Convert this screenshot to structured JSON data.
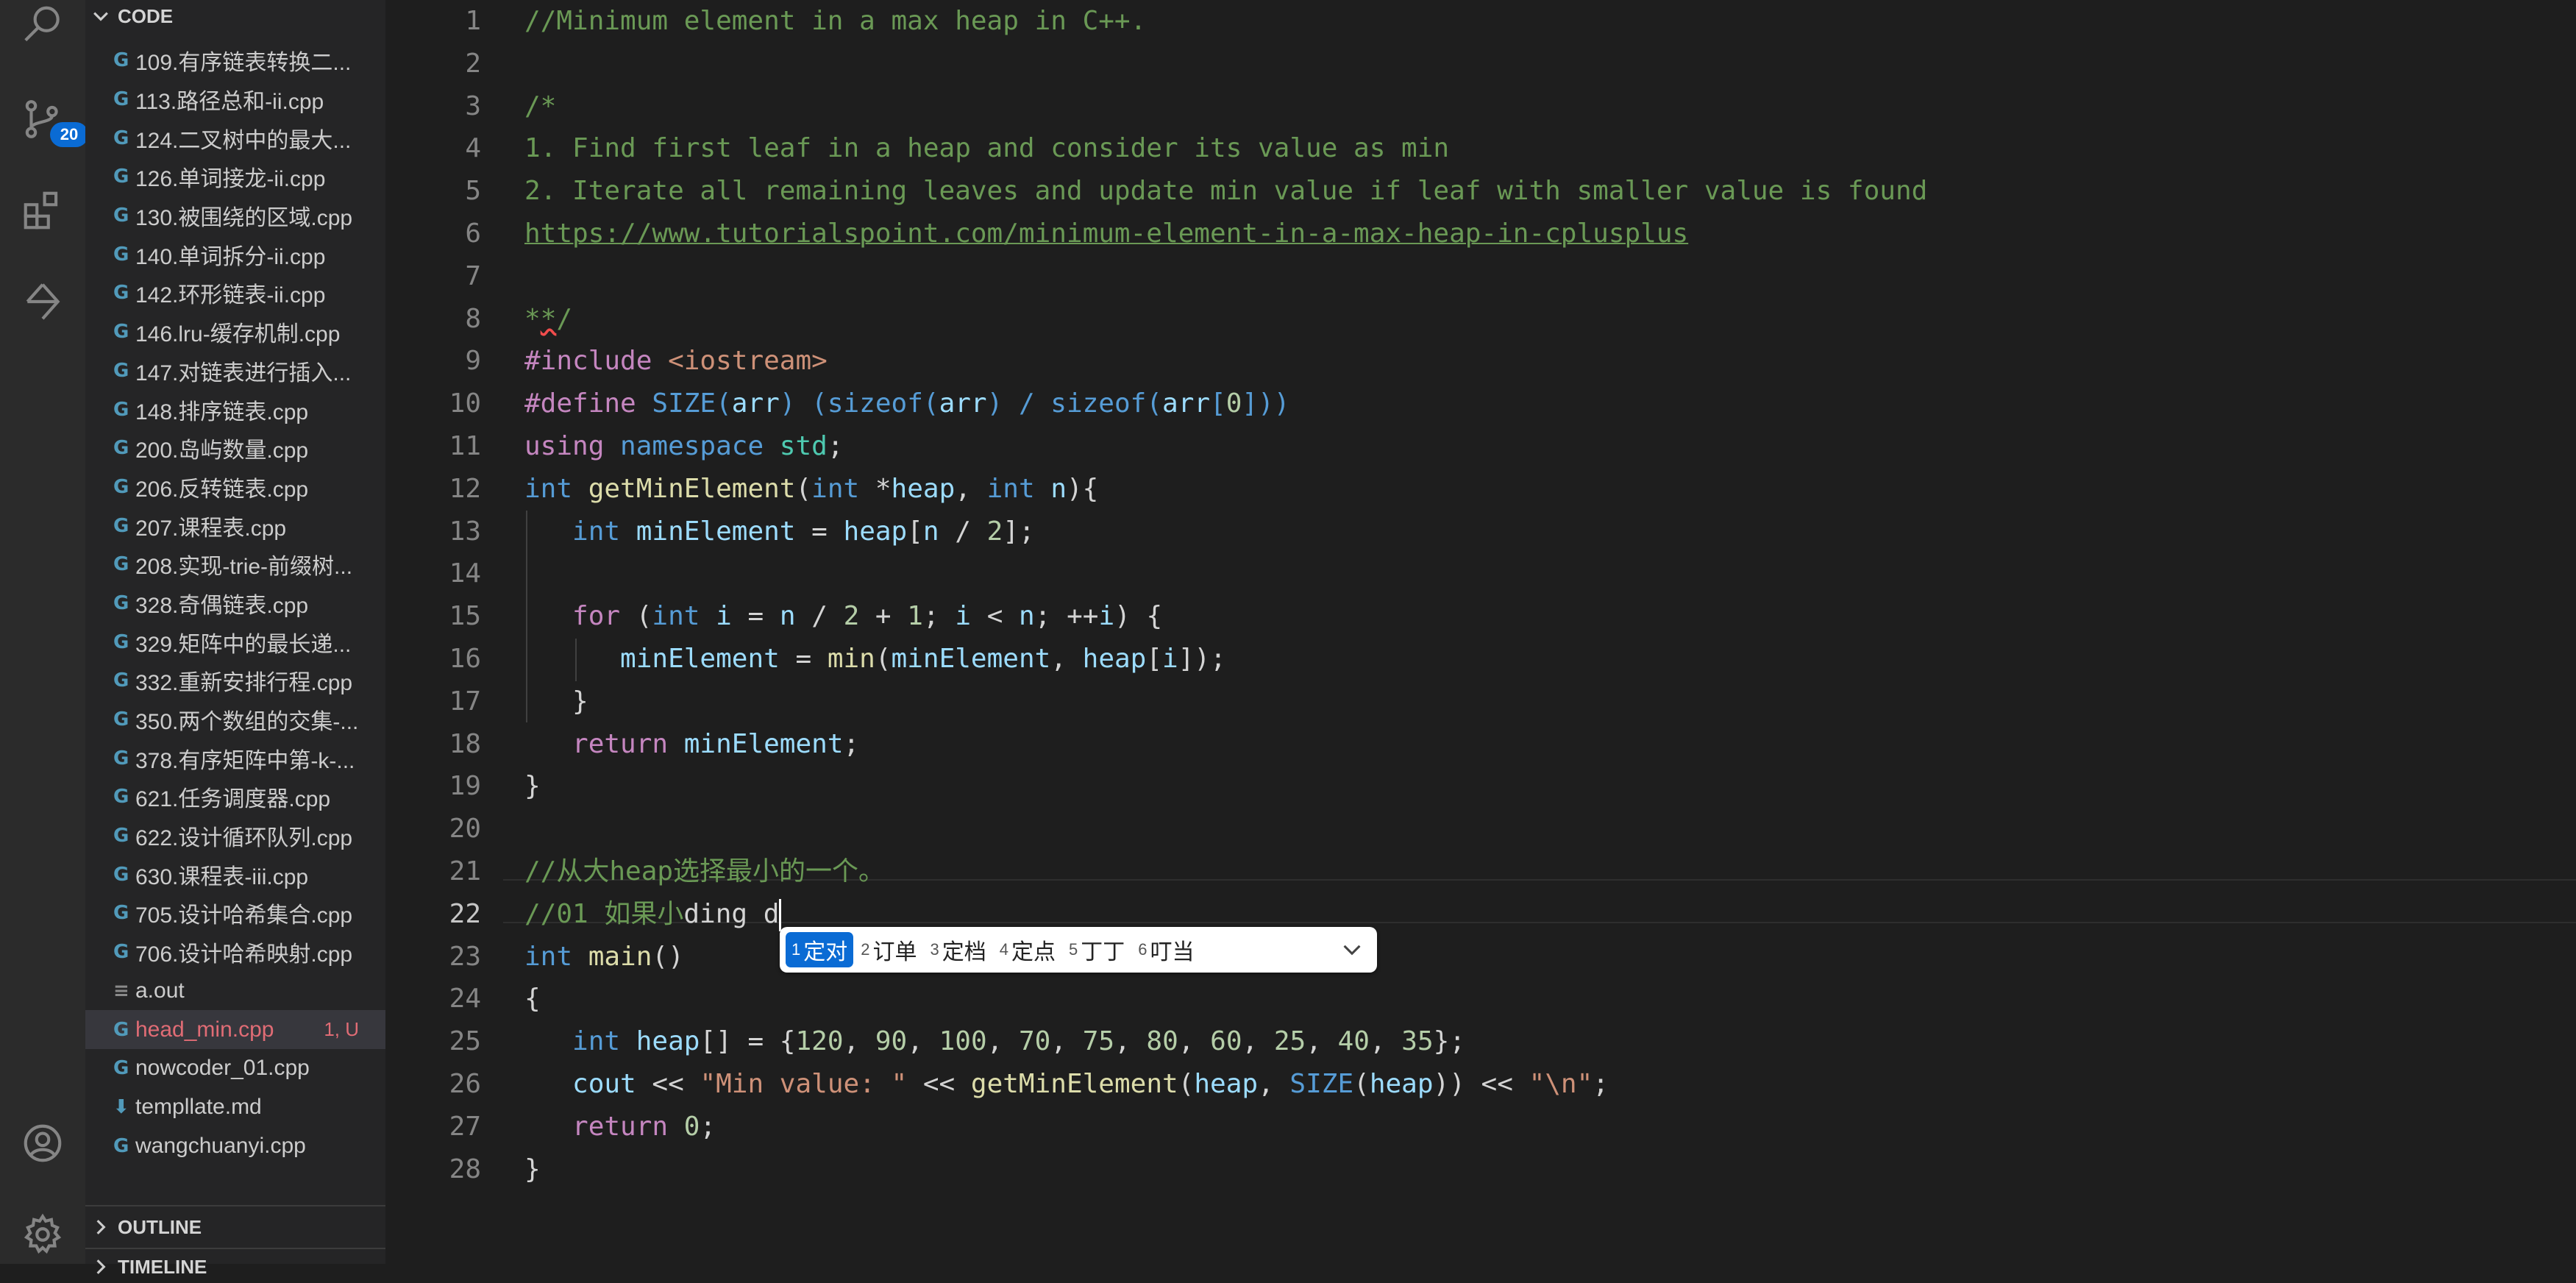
{
  "activity_bar": {
    "source_control_badge": "20"
  },
  "sidebar": {
    "code_section": "CODE",
    "files": [
      {
        "name": "109.有序链表转换二...",
        "icon": "cpp-icon"
      },
      {
        "name": "113.路径总和-ii.cpp",
        "icon": "cpp-icon"
      },
      {
        "name": "124.二叉树中的最大...",
        "icon": "cpp-icon"
      },
      {
        "name": "126.单词接龙-ii.cpp",
        "icon": "cpp-icon"
      },
      {
        "name": "130.被围绕的区域.cpp",
        "icon": "cpp-icon"
      },
      {
        "name": "140.单词拆分-ii.cpp",
        "icon": "cpp-icon"
      },
      {
        "name": "142.环形链表-ii.cpp",
        "icon": "cpp-icon"
      },
      {
        "name": "146.lru-缓存机制.cpp",
        "icon": "cpp-icon"
      },
      {
        "name": "147.对链表进行插入...",
        "icon": "cpp-icon"
      },
      {
        "name": "148.排序链表.cpp",
        "icon": "cpp-icon"
      },
      {
        "name": "200.岛屿数量.cpp",
        "icon": "cpp-icon"
      },
      {
        "name": "206.反转链表.cpp",
        "icon": "cpp-icon"
      },
      {
        "name": "207.课程表.cpp",
        "icon": "cpp-icon"
      },
      {
        "name": "208.实现-trie-前缀树...",
        "icon": "cpp-icon"
      },
      {
        "name": "328.奇偶链表.cpp",
        "icon": "cpp-icon"
      },
      {
        "name": "329.矩阵中的最长递...",
        "icon": "cpp-icon"
      },
      {
        "name": "332.重新安排行程.cpp",
        "icon": "cpp-icon"
      },
      {
        "name": "350.两个数组的交集-...",
        "icon": "cpp-icon"
      },
      {
        "name": "378.有序矩阵中第-k-...",
        "icon": "cpp-icon"
      },
      {
        "name": "621.任务调度器.cpp",
        "icon": "cpp-icon"
      },
      {
        "name": "622.设计循环队列.cpp",
        "icon": "cpp-icon"
      },
      {
        "name": "630.课程表-iii.cpp",
        "icon": "cpp-icon"
      },
      {
        "name": "705.设计哈希集合.cpp",
        "icon": "cpp-icon"
      },
      {
        "name": "706.设计哈希映射.cpp",
        "icon": "cpp-icon"
      },
      {
        "name": "a.out",
        "icon": "file-lines-icon"
      },
      {
        "name": "head_min.cpp",
        "icon": "cpp-icon",
        "status": "1, U",
        "selected": true,
        "modified": true
      },
      {
        "name": "nowcoder_01.cpp",
        "icon": "cpp-icon"
      },
      {
        "name": "templlate.md",
        "icon": "markdown-icon"
      },
      {
        "name": "wangchuanyi.cpp",
        "icon": "cpp-icon"
      }
    ],
    "outline_section": "OUTLINE",
    "timeline_section": "TIMELINE"
  },
  "editor": {
    "file": "head_min.cpp",
    "active_line": 22,
    "lines": [
      [
        [
          "//Minimum element in a max heap in C++.",
          "cm"
        ]
      ],
      [],
      [
        [
          "/*",
          "cm"
        ]
      ],
      [
        [
          "1. Find first leaf in a heap and consider its value as min",
          "cm"
        ]
      ],
      [
        [
          "2. Iterate all remaining leaves and update min value if leaf with smaller value is found",
          "cm"
        ]
      ],
      [
        [
          "https://www.tutorialspoint.com/minimum-element-in-a-max-heap-in-cplusplus",
          "cm lnk"
        ]
      ],
      [],
      [
        [
          "*",
          "cm"
        ],
        [
          "*",
          "cm squig"
        ],
        [
          "/",
          "cm"
        ]
      ],
      [
        [
          "#include ",
          "ctl"
        ],
        [
          "<iostream>",
          "str"
        ]
      ],
      [
        [
          "#define ",
          "ctl"
        ],
        [
          "SIZE",
          "kw"
        ],
        [
          "(",
          "kw"
        ],
        [
          "arr",
          "vr"
        ],
        [
          ") (sizeof(",
          "kw"
        ],
        [
          "arr",
          "vr"
        ],
        [
          ") / sizeof(",
          "kw"
        ],
        [
          "arr",
          "vr"
        ],
        [
          "[",
          "kw"
        ],
        [
          "0",
          "num"
        ],
        [
          "]))",
          "kw"
        ]
      ],
      [
        [
          "using ",
          "ctl"
        ],
        [
          "namespace ",
          "kw"
        ],
        [
          "std",
          "ty"
        ],
        [
          ";",
          ""
        ]
      ],
      [
        [
          "int ",
          "kw"
        ],
        [
          "getMinElement",
          "fn"
        ],
        [
          "(",
          ""
        ],
        [
          "int ",
          "kw"
        ],
        [
          "*",
          ""
        ],
        [
          "heap",
          "vr"
        ],
        [
          ", ",
          ""
        ],
        [
          "int ",
          "kw"
        ],
        [
          "n",
          "vr"
        ],
        [
          "){",
          ""
        ]
      ],
      [
        [
          "   ",
          ""
        ],
        [
          "int ",
          "kw"
        ],
        [
          "minElement",
          "vr"
        ],
        [
          " = ",
          ""
        ],
        [
          "heap",
          "vr"
        ],
        [
          "[",
          ""
        ],
        [
          "n",
          "vr"
        ],
        [
          " / ",
          ""
        ],
        [
          "2",
          "num"
        ],
        [
          "];",
          ""
        ]
      ],
      [],
      [
        [
          "   ",
          ""
        ],
        [
          "for ",
          "ctl"
        ],
        [
          "(",
          ""
        ],
        [
          "int ",
          "kw"
        ],
        [
          "i",
          "vr"
        ],
        [
          " = ",
          ""
        ],
        [
          "n",
          "vr"
        ],
        [
          " / ",
          ""
        ],
        [
          "2",
          "num"
        ],
        [
          " + ",
          ""
        ],
        [
          "1",
          "num"
        ],
        [
          "; ",
          ""
        ],
        [
          "i",
          "vr"
        ],
        [
          " < ",
          ""
        ],
        [
          "n",
          "vr"
        ],
        [
          "; ++",
          ""
        ],
        [
          "i",
          "vr"
        ],
        [
          ") {",
          ""
        ]
      ],
      [
        [
          "      ",
          ""
        ],
        [
          "minElement",
          "vr"
        ],
        [
          " = ",
          ""
        ],
        [
          "min",
          "fn"
        ],
        [
          "(",
          ""
        ],
        [
          "minElement",
          "vr"
        ],
        [
          ", ",
          ""
        ],
        [
          "heap",
          "vr"
        ],
        [
          "[",
          ""
        ],
        [
          "i",
          "vr"
        ],
        [
          "]);",
          ""
        ]
      ],
      [
        [
          "   }",
          ""
        ]
      ],
      [
        [
          "   ",
          ""
        ],
        [
          "return ",
          "ctl"
        ],
        [
          "minElement",
          "vr"
        ],
        [
          ";",
          ""
        ]
      ],
      [
        [
          "}",
          ""
        ]
      ],
      [],
      [
        [
          "//从大heap选择最小的一个。",
          "cm"
        ]
      ],
      [
        [
          "//01 如果小",
          "cm"
        ],
        [
          "ding d",
          ""
        ]
      ],
      [
        [
          "int ",
          "kw"
        ],
        [
          "main",
          "fn"
        ],
        [
          "()",
          ""
        ]
      ],
      [
        [
          "{",
          ""
        ]
      ],
      [
        [
          "   ",
          ""
        ],
        [
          "int ",
          "kw"
        ],
        [
          "heap",
          "vr"
        ],
        [
          "[] = {",
          ""
        ],
        [
          "120",
          "num"
        ],
        [
          ", ",
          ""
        ],
        [
          "90",
          "num"
        ],
        [
          ", ",
          ""
        ],
        [
          "100",
          "num"
        ],
        [
          ", ",
          ""
        ],
        [
          "70",
          "num"
        ],
        [
          ", ",
          ""
        ],
        [
          "75",
          "num"
        ],
        [
          ", ",
          ""
        ],
        [
          "80",
          "num"
        ],
        [
          ", ",
          ""
        ],
        [
          "60",
          "num"
        ],
        [
          ", ",
          ""
        ],
        [
          "25",
          "num"
        ],
        [
          ", ",
          ""
        ],
        [
          "40",
          "num"
        ],
        [
          ", ",
          ""
        ],
        [
          "35",
          "num"
        ],
        [
          "};",
          ""
        ]
      ],
      [
        [
          "   ",
          ""
        ],
        [
          "cout",
          "vr"
        ],
        [
          " << ",
          ""
        ],
        [
          "\"Min value: \"",
          "str"
        ],
        [
          " << ",
          ""
        ],
        [
          "getMinElement",
          "fn"
        ],
        [
          "(",
          ""
        ],
        [
          "heap",
          "vr"
        ],
        [
          ", ",
          ""
        ],
        [
          "SIZE",
          "kw"
        ],
        [
          "(",
          ""
        ],
        [
          "heap",
          "vr"
        ],
        [
          ")) << ",
          ""
        ],
        [
          "\"\\n\"",
          "str"
        ],
        [
          ";",
          ""
        ]
      ],
      [
        [
          "   ",
          ""
        ],
        [
          "return ",
          "ctl"
        ],
        [
          "0",
          "num"
        ],
        [
          ";",
          ""
        ]
      ],
      [
        [
          "}",
          ""
        ]
      ]
    ]
  },
  "ime": {
    "candidates": [
      {
        "num": "1",
        "text": "定对",
        "active": true
      },
      {
        "num": "2",
        "text": "订单"
      },
      {
        "num": "3",
        "text": "定档"
      },
      {
        "num": "4",
        "text": "定点"
      },
      {
        "num": "5",
        "text": "丁丁"
      },
      {
        "num": "6",
        "text": "叮当"
      }
    ]
  }
}
